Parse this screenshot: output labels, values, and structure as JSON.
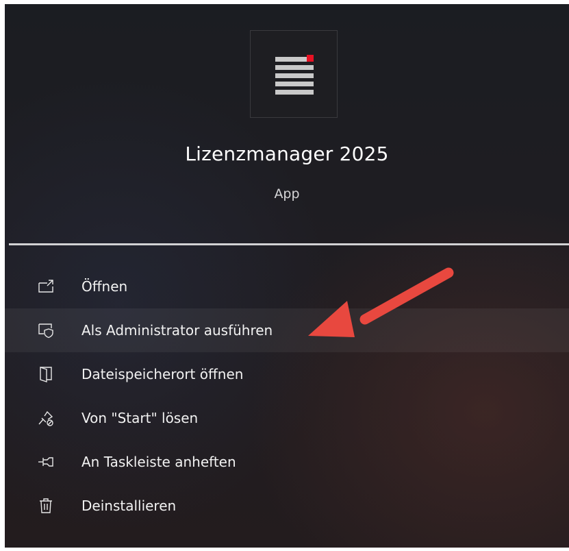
{
  "app": {
    "title": "Lizenzmanager 2025",
    "type": "App",
    "icon": "license-document-icon",
    "accent": "#e81123"
  },
  "menu": {
    "items": [
      {
        "label": "Öffnen",
        "icon": "open-window-icon",
        "highlighted": false
      },
      {
        "label": "Als Administrator ausführen",
        "icon": "admin-shield-icon",
        "highlighted": true
      },
      {
        "label": "Dateispeicherort öffnen",
        "icon": "folder-door-icon",
        "highlighted": false
      },
      {
        "label": "Von \"Start\" lösen",
        "icon": "unpin-icon",
        "highlighted": false
      },
      {
        "label": "An Taskleiste anheften",
        "icon": "pin-taskbar-icon",
        "highlighted": false
      },
      {
        "label": "Deinstallieren",
        "icon": "trash-icon",
        "highlighted": false
      }
    ]
  },
  "annotation": {
    "icon": "red-arrow-icon",
    "color": "#e8483f"
  }
}
